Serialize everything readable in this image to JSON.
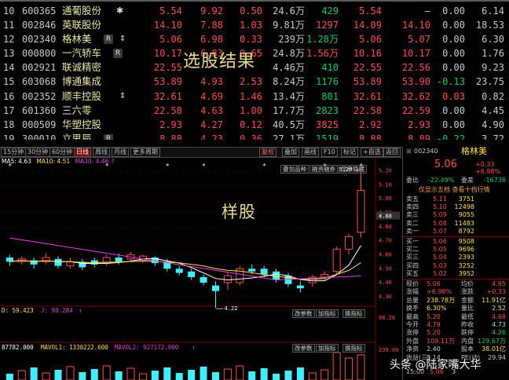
{
  "stock_list": [
    {
      "idx": "10",
      "code": "600365",
      "name": "通葡股份",
      "tag": "✱",
      "tag_type": "star",
      "v1": "5.54",
      "v2": "9.92",
      "v3": "0.50",
      "v4": "24.6万",
      "v5": "429",
      "v6": "5.54",
      "v7": "—",
      "v8": "0.00",
      "v9": "6.14",
      "c1": "red",
      "c2": "red",
      "c3": "red",
      "c5": "green",
      "c6": "red",
      "c7": "white",
      "c8": "white"
    },
    {
      "idx": "11",
      "code": "002846",
      "name": "英联股份",
      "tag": "",
      "tag_type": "",
      "v1": "14.10",
      "v2": "7.88",
      "v3": "1.03",
      "v4": "9.81万",
      "v5": "1297",
      "v6": "14.09",
      "v7": "14.10",
      "v8": "0.00",
      "v9": "18.53",
      "c1": "red",
      "c2": "red",
      "c3": "red",
      "c5": "red",
      "c6": "red",
      "c7": "red",
      "c8": "white"
    },
    {
      "idx": "12",
      "code": "002340",
      "name": "格林美",
      "tag": "R",
      "tag_type": "box",
      "tag2": "⇕",
      "v1": "5.06",
      "v2": "6.98",
      "v3": "0.33",
      "v4": "239万",
      "v5": "1.28万",
      "v6": "5.06",
      "v7": "5.07",
      "v8": "0.00",
      "v9": "6.30",
      "c1": "red",
      "c2": "red",
      "c3": "red",
      "c5": "green",
      "c6": "red",
      "c7": "red",
      "c8": "white"
    },
    {
      "idx": "13",
      "code": "000800",
      "name": "一汽轿车",
      "tag": "R",
      "tag_type": "box",
      "v1": "10.17",
      "v2": "6.83",
      "v3": "0.65",
      "v4": "24.8万",
      "v5": "1.56万",
      "v6": "10.16",
      "v7": "10.17",
      "v8": "0.00",
      "v9": "1.76",
      "c1": "red",
      "c2": "red",
      "c3": "red",
      "c5": "red",
      "c6": "red",
      "c7": "red",
      "c8": "white"
    },
    {
      "idx": "14",
      "code": "002921",
      "name": "联诚精密",
      "tag": "",
      "tag_type": "",
      "v1": "22.55",
      "v2": "",
      "v3": "",
      "v4": "4.46万",
      "v5": "410",
      "v6": "22.55",
      "v7": "22.56",
      "v8": "0.00",
      "v9": "9.23",
      "c1": "red",
      "c2": "red",
      "c3": "red",
      "c5": "green",
      "c6": "red",
      "c7": "red",
      "c8": "white"
    },
    {
      "idx": "15",
      "code": "603068",
      "name": "博通集成",
      "tag": "",
      "tag_type": "",
      "v1": "53.89",
      "v2": "4.93",
      "v3": "2.53",
      "v4": "8.24万",
      "v5": "1176",
      "v6": "53.89",
      "v7": "53.90",
      "v8": "-0.13",
      "v9": "23.75",
      "c1": "red",
      "c2": "red",
      "c3": "red",
      "c5": "green",
      "c6": "red",
      "c7": "red",
      "c8": "green"
    },
    {
      "idx": "16",
      "code": "002352",
      "name": "顺丰控股",
      "tag": "⇕",
      "tag_type": "arrow",
      "v1": "32.61",
      "v2": "4.69",
      "v3": "1.46",
      "v4": "13.4万",
      "v5": "801",
      "v6": "32.61",
      "v7": "32.62",
      "v8": "0.03",
      "v9": "0.82",
      "c1": "red",
      "c2": "red",
      "c3": "red",
      "c5": "green",
      "c6": "red",
      "c7": "red",
      "c8": "red"
    },
    {
      "idx": "17",
      "code": "601360",
      "name": "三六零",
      "tag": "",
      "tag_type": "",
      "v1": "22.58",
      "v2": "4.63",
      "v3": "1.00",
      "v4": "17.7万",
      "v5": "2823",
      "v6": "22.58",
      "v7": "22.59",
      "v8": "0.00",
      "v9": "4.45",
      "c1": "red",
      "c2": "red",
      "c3": "red",
      "c5": "green",
      "c6": "red",
      "c7": "red",
      "c8": "white"
    },
    {
      "idx": "18",
      "code": "000509",
      "name": "华塑控股",
      "tag": "",
      "tag_type": "",
      "v1": "2.93",
      "v2": "4.27",
      "v3": "0.12",
      "v4": "40.5万",
      "v5": "3825",
      "v6": "2.92",
      "v7": "2.93",
      "v8": "0.00",
      "v9": "4.90",
      "c1": "red",
      "c2": "red",
      "c3": "red",
      "c5": "red",
      "c6": "red",
      "c7": "red",
      "c8": "white"
    },
    {
      "idx": "19",
      "code": "300010",
      "name": "立思辰",
      "tag": "R",
      "tag_type": "box",
      "v1": "8.88",
      "v2": "4.23",
      "v3": "0.36",
      "v4": "27.1万",
      "v5": "1519",
      "v6": "8.88",
      "v7": "8.89",
      "v8": "-0.22",
      "v9": "3.72",
      "c1": "red",
      "c2": "red",
      "c3": "red",
      "c5": "green",
      "c6": "red",
      "c7": "red",
      "c8": "green"
    }
  ],
  "overlay": {
    "title1": "选股结果",
    "title2": "样股"
  },
  "toolbar": {
    "periods": [
      "15分钟",
      "30分钟",
      "60分钟",
      "日线",
      "周线",
      "月线",
      "更多周期"
    ],
    "right": [
      "复权",
      "叠加",
      "画线",
      "F10",
      "标记",
      "+自选",
      "返回"
    ],
    "arrow": "▼"
  },
  "chart": {
    "legend": {
      "ma5": "MA5: 4.63",
      "ma10": "MA10: 4.51",
      "ma30": "MA30: 4.46",
      "arrow": "↑"
    },
    "buttons1": [
      "叠加品种",
      "融资融券",
      "显示隐藏"
    ],
    "y_labels": [
      "5.20",
      "5.10",
      "5.00",
      "4.90",
      "4.80",
      "4.70",
      "4.60",
      "4.50",
      "4.40",
      "4.30"
    ],
    "last_price": "4.88",
    "high_mark": "5.20",
    "low_mark": "4.22",
    "kdj": {
      "d": "D: 59.423",
      "j": "J: 98.284",
      "arrow": "↑",
      "y_top": "98.28"
    },
    "vol": {
      "v": "87782.000",
      "mavol1": "MAVOL1: 1330222.600",
      "mavol2": "MAVOL2: 927172.000",
      "arrow": "↑",
      "y_top": "239.00"
    },
    "sub_buttons": [
      "改参数",
      "加指标",
      "换指标"
    ],
    "colors": {
      "up": "#ff4b4b",
      "down": "#3ef0ff",
      "ma5": "#ffffff",
      "ma10": "#ffe04a",
      "ma30": "#e040e0"
    },
    "candles": [
      {
        "o": 4.58,
        "c": 4.55,
        "h": 4.6,
        "l": 4.52
      },
      {
        "o": 4.55,
        "c": 4.57,
        "h": 4.59,
        "l": 4.53
      },
      {
        "o": 4.56,
        "c": 4.53,
        "h": 4.58,
        "l": 4.5
      },
      {
        "o": 4.55,
        "c": 4.58,
        "h": 4.61,
        "l": 4.53
      },
      {
        "o": 4.57,
        "c": 4.52,
        "h": 4.59,
        "l": 4.5
      },
      {
        "o": 4.52,
        "c": 4.55,
        "h": 4.58,
        "l": 4.5
      },
      {
        "o": 4.55,
        "c": 4.51,
        "h": 4.57,
        "l": 4.49
      },
      {
        "o": 4.56,
        "c": 4.53,
        "h": 4.58,
        "l": 4.51
      },
      {
        "o": 4.54,
        "c": 4.58,
        "h": 4.6,
        "l": 4.52
      },
      {
        "o": 4.58,
        "c": 4.55,
        "h": 4.61,
        "l": 4.53
      },
      {
        "o": 4.57,
        "c": 4.6,
        "h": 4.62,
        "l": 4.55
      },
      {
        "o": 4.56,
        "c": 4.59,
        "h": 4.6,
        "l": 4.54
      },
      {
        "o": 4.58,
        "c": 4.54,
        "h": 4.59,
        "l": 4.52
      },
      {
        "o": 4.55,
        "c": 4.5,
        "h": 4.57,
        "l": 4.48
      },
      {
        "o": 4.5,
        "c": 4.47,
        "h": 4.52,
        "l": 4.45
      },
      {
        "o": 4.48,
        "c": 4.44,
        "h": 4.5,
        "l": 4.42
      },
      {
        "o": 4.44,
        "c": 4.4,
        "h": 4.46,
        "l": 4.38
      },
      {
        "o": 4.38,
        "c": 4.34,
        "h": 4.41,
        "l": 4.22
      },
      {
        "o": 4.4,
        "c": 4.45,
        "h": 4.47,
        "l": 4.35
      },
      {
        "o": 4.4,
        "c": 4.5,
        "h": 4.52,
        "l": 4.38
      },
      {
        "o": 4.5,
        "c": 4.48,
        "h": 4.53,
        "l": 4.46
      },
      {
        "o": 4.5,
        "c": 4.46,
        "h": 4.52,
        "l": 4.44
      },
      {
        "o": 4.48,
        "c": 4.42,
        "h": 4.5,
        "l": 4.4
      },
      {
        "o": 4.45,
        "c": 4.39,
        "h": 4.47,
        "l": 4.37
      },
      {
        "o": 4.38,
        "c": 4.36,
        "h": 4.41,
        "l": 4.33
      },
      {
        "o": 4.4,
        "c": 4.44,
        "h": 4.46,
        "l": 4.37
      },
      {
        "o": 4.44,
        "c": 4.46,
        "h": 4.48,
        "l": 4.42
      },
      {
        "o": 4.48,
        "c": 4.64,
        "h": 4.66,
        "l": 4.46
      },
      {
        "o": 4.64,
        "c": 4.73,
        "h": 4.75,
        "l": 4.6
      },
      {
        "o": 4.76,
        "c": 5.06,
        "h": 5.2,
        "l": 4.72
      }
    ]
  },
  "right_panel": {
    "code": "002340",
    "name": "格林美",
    "price": "5.06",
    "change": "+0.33",
    "change_pct": "+6.98%",
    "row_ratio": {
      "l1": "委比",
      "v1": "-22.49%",
      "l2": "委差",
      "v2": "-16738"
    },
    "link": "仅显示五档 查看十档行情",
    "asks": [
      {
        "label": "卖五",
        "price": "5.11",
        "vol": "3751"
      },
      {
        "label": "卖四",
        "price": "5.10",
        "vol": "12498"
      },
      {
        "label": "卖三",
        "price": "5.09",
        "vol": "9055"
      },
      {
        "label": "卖二",
        "price": "5.08",
        "vol": "11483"
      },
      {
        "label": "卖一",
        "price": "5.07",
        "vol": "8792"
      }
    ],
    "bids": [
      {
        "label": "买一",
        "price": "5.06",
        "vol": "9508"
      },
      {
        "label": "买二",
        "price": "5.05",
        "vol": "9696"
      },
      {
        "label": "买三",
        "price": "5.04",
        "vol": "2393"
      },
      {
        "label": "买四",
        "price": "5.03",
        "vol": "3252"
      },
      {
        "label": "买五",
        "price": "5.02",
        "vol": "3952"
      }
    ],
    "stats": [
      {
        "l1": "现价",
        "v1": "5.06",
        "l2": "均价",
        "v2": "4.95"
      },
      {
        "l1": "涨幅",
        "v1": "+6.98%",
        "l2": "涨跌",
        "v2": "+0.33"
      },
      {
        "l1": "总量",
        "v1": "238.78万",
        "l2": "金额",
        "v2": "11.91亿"
      },
      {
        "l1": "换手",
        "v1": "6.30%",
        "l2": "量比",
        "v2": "2.52"
      },
      {
        "l1": "最高",
        "v1": "5.20",
        "l2": "最低",
        "v2": "4.68"
      },
      {
        "l1": "今开",
        "v1": "4.79",
        "l2": "昨收",
        "v2": "4.73"
      },
      {
        "l1": "涨停",
        "v1": "5.20",
        "l2": "跌停",
        "v2": "4.26"
      },
      {
        "l1": "外盘",
        "v1": "109.11万",
        "l2": "内盘",
        "v2": "129.67万"
      },
      {
        "l1": "净资",
        "v1": "2.40",
        "l2": "股本",
        "v2": "38.01亿"
      },
      {
        "l1": "收益(三)",
        "v1": "0.14",
        "l2": "PE(动)",
        "v2": "29.94"
      }
    ],
    "bottom": {
      "time": "15:00",
      "price": "5.06",
      "vol": "3"
    }
  },
  "watermark": "头条 @陆家嘴大华"
}
